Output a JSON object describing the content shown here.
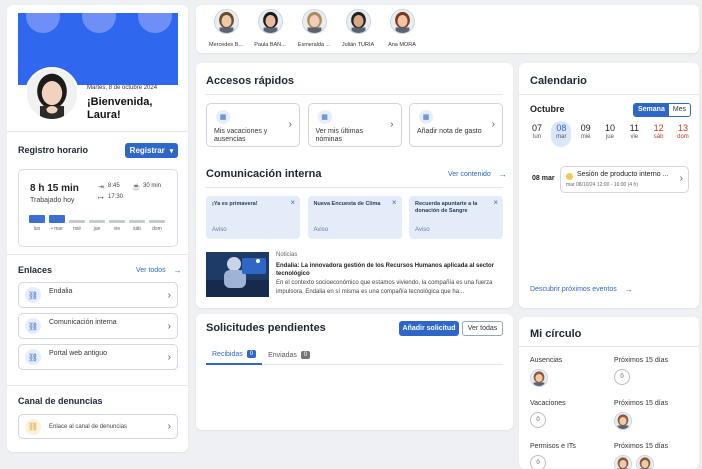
{
  "profile": {
    "date": "Martes, 8 de octubre 2024",
    "greeting": "¡Bienvenida, Laura!"
  },
  "registro": {
    "title": "Registro horario",
    "button": "Registrar",
    "worked": "8 h 15 min",
    "worked_label": "Trabajado hoy",
    "in_time": "8:45",
    "out_time": "17:30",
    "pause": "30 min",
    "days": [
      {
        "label": "lun",
        "filled": true
      },
      {
        "label": "• mar",
        "filled": true
      },
      {
        "label": "mié",
        "filled": false
      },
      {
        "label": "jue",
        "filled": false
      },
      {
        "label": "vie",
        "filled": false
      },
      {
        "label": "sáb",
        "filled": false
      },
      {
        "label": "dom",
        "filled": false
      }
    ]
  },
  "enlaces": {
    "title": "Enlaces",
    "see_all": "Ver todos",
    "items": [
      "Endalia",
      "Comunicación interna",
      "Portal web antiguo"
    ]
  },
  "denuncias": {
    "title": "Canal de denuncias",
    "item": "Enlace al canal de denuncias"
  },
  "people": [
    {
      "name": "Mercedes B..."
    },
    {
      "name": "Paula BAN..."
    },
    {
      "name": "Esmeralda ..."
    },
    {
      "name": "Julián TURIA"
    },
    {
      "name": "Ana MORA"
    }
  ],
  "accesos": {
    "title": "Accesos rápidos",
    "items": [
      "Mis vacaciones y ausencias",
      "Ver mis últimas nóminas",
      "Añadir nota de gasto"
    ]
  },
  "comunicacion": {
    "title": "Comunicación interna",
    "see": "Ver contenido",
    "notices": [
      {
        "title": "¡Ya es primavera!",
        "tag": "Aviso"
      },
      {
        "title": "Nueva Encuesta de Clima",
        "tag": "Aviso"
      },
      {
        "title": "Recuerda apuntarte a la donación de Sangre",
        "tag": "Aviso"
      }
    ],
    "news": {
      "category": "Noticias",
      "headline": "Endalia: La innovadora gestión de los Recursos Humanos aplicada al sector tecnológico",
      "body": "En el contexto socioeconómico que estamos viviendo, la compañía es una fuerza impulsora. Endalia en sí misma es una compañía tecnológica que ha..."
    }
  },
  "solicitudes": {
    "title": "Solicitudes pendientes",
    "add": "Añadir solicitud",
    "all": "Ver todas",
    "tabs": [
      {
        "label": "Recibidas",
        "count": "0"
      },
      {
        "label": "Enviadas",
        "count": "0"
      }
    ]
  },
  "calendario": {
    "title": "Calendario",
    "month": "Octubre",
    "toggle": [
      "Semana",
      "Mes"
    ],
    "days": [
      {
        "num": "07",
        "label": "lun"
      },
      {
        "num": "08",
        "label": "mar"
      },
      {
        "num": "09",
        "label": "mié"
      },
      {
        "num": "10",
        "label": "jue"
      },
      {
        "num": "11",
        "label": "vie"
      },
      {
        "num": "12",
        "label": "sáb"
      },
      {
        "num": "13",
        "label": "dom"
      }
    ],
    "event_day": "08 mar",
    "event_title": "Sesión de producto interno ...",
    "event_time": "mar 08/10/24 12:00 - 16:00 (4 h)",
    "discover": "Descubrir próximos eventos"
  },
  "circulo": {
    "title": "Mi círculo",
    "rows": [
      {
        "left": "Ausencias",
        "right": "Próximos 15 días",
        "left_count": "",
        "right_count": "0"
      },
      {
        "left": "Vacaciones",
        "right": "Próximos 15 días",
        "left_count": "0",
        "right_count": ""
      },
      {
        "left": "Permisos e ITs",
        "right": "Próximos 15 días",
        "left_count": "0",
        "right_count": ""
      }
    ]
  },
  "colors": {
    "accent": "#2f67c7",
    "banner": "#2f67ef",
    "weekend": "#c0392b"
  }
}
